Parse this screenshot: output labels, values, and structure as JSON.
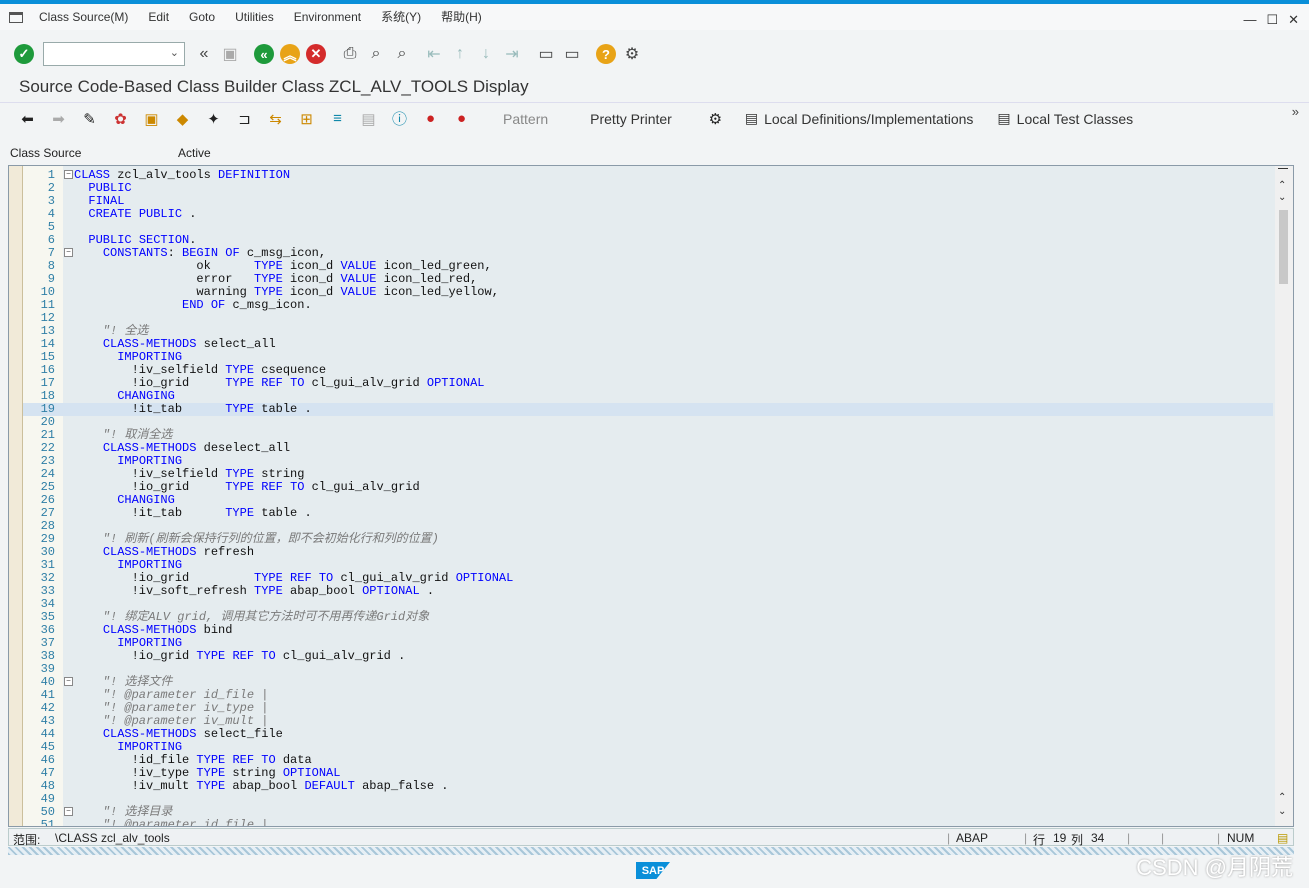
{
  "menubar": {
    "items": [
      "Class Source(M)",
      "Edit",
      "Goto",
      "Utilities",
      "Environment",
      "系统(Y)",
      "帮助(H)"
    ],
    "window_controls": [
      "—",
      "☐",
      "✕"
    ]
  },
  "toolbar": {
    "command_field_value": "",
    "icons": [
      "enter-icon",
      "back-double-icon",
      "save-icon",
      "back-icon",
      "exit-icon",
      "cancel-icon",
      "print-icon",
      "find-icon",
      "find-next-icon",
      "first-page-icon",
      "prev-page-icon",
      "next-page-icon",
      "last-page-icon",
      "new-session-icon",
      "shortcut-icon",
      "help-icon",
      "settings-icon"
    ]
  },
  "title": "Source Code-Based Class Builder Class ZCL_ALV_TOOLS Display",
  "app_toolbar": {
    "pattern_label": "Pattern",
    "pretty_printer_label": "Pretty Printer",
    "local_defs_label": "Local Definitions/Implementations",
    "local_tests_label": "Local Test Classes"
  },
  "editor": {
    "source_label": "Class Source",
    "status_label": "Active",
    "highlight_line": 19,
    "lines": [
      {
        "no": "1",
        "fold": "⊟",
        "t": "CLASS zcl_alv_tools DEFINITION"
      },
      {
        "no": "2",
        "t": "  PUBLIC"
      },
      {
        "no": "3",
        "t": "  FINAL"
      },
      {
        "no": "4",
        "t": "  CREATE PUBLIC ."
      },
      {
        "no": "5",
        "t": ""
      },
      {
        "no": "6",
        "t": "  PUBLIC SECTION."
      },
      {
        "no": "7",
        "fold": "⊟",
        "t": "    CONSTANTS: BEGIN OF c_msg_icon,"
      },
      {
        "no": "8",
        "t": "                 ok      TYPE icon_d VALUE icon_led_green,"
      },
      {
        "no": "9",
        "t": "                 error   TYPE icon_d VALUE icon_led_red,"
      },
      {
        "no": "10",
        "t": "                 warning TYPE icon_d VALUE icon_led_yellow,"
      },
      {
        "no": "11",
        "t": "               END OF c_msg_icon."
      },
      {
        "no": "12",
        "t": ""
      },
      {
        "no": "13",
        "t": "    \"! 全选"
      },
      {
        "no": "14",
        "t": "    CLASS-METHODS select_all"
      },
      {
        "no": "15",
        "t": "      IMPORTING"
      },
      {
        "no": "16",
        "t": "        !iv_selfield TYPE csequence"
      },
      {
        "no": "17",
        "t": "        !io_grid     TYPE REF TO cl_gui_alv_grid OPTIONAL"
      },
      {
        "no": "18",
        "t": "      CHANGING"
      },
      {
        "no": "19",
        "t": "        !it_tab      TYPE table ."
      },
      {
        "no": "20",
        "t": ""
      },
      {
        "no": "21",
        "t": "    \"! 取消全选"
      },
      {
        "no": "22",
        "t": "    CLASS-METHODS deselect_all"
      },
      {
        "no": "23",
        "t": "      IMPORTING"
      },
      {
        "no": "24",
        "t": "        !iv_selfield TYPE string"
      },
      {
        "no": "25",
        "t": "        !io_grid     TYPE REF TO cl_gui_alv_grid"
      },
      {
        "no": "26",
        "t": "      CHANGING"
      },
      {
        "no": "27",
        "t": "        !it_tab      TYPE table ."
      },
      {
        "no": "28",
        "t": ""
      },
      {
        "no": "29",
        "t": "    \"! 刷新(刷新会保持行列的位置，即不会初始化行和列的位置)"
      },
      {
        "no": "30",
        "t": "    CLASS-METHODS refresh"
      },
      {
        "no": "31",
        "t": "      IMPORTING"
      },
      {
        "no": "32",
        "t": "        !io_grid         TYPE REF TO cl_gui_alv_grid OPTIONAL"
      },
      {
        "no": "33",
        "t": "        !iv_soft_refresh TYPE abap_bool OPTIONAL ."
      },
      {
        "no": "34",
        "t": ""
      },
      {
        "no": "35",
        "t": "    \"! 绑定ALV grid, 调用其它方法时可不用再传递Grid对象"
      },
      {
        "no": "36",
        "t": "    CLASS-METHODS bind"
      },
      {
        "no": "37",
        "t": "      IMPORTING"
      },
      {
        "no": "38",
        "t": "        !io_grid TYPE REF TO cl_gui_alv_grid ."
      },
      {
        "no": "39",
        "t": ""
      },
      {
        "no": "40",
        "fold": "⊟",
        "t": "    \"! 选择文件"
      },
      {
        "no": "41",
        "t": "    \"! @parameter id_file |"
      },
      {
        "no": "42",
        "t": "    \"! @parameter iv_type |"
      },
      {
        "no": "43",
        "t": "    \"! @parameter iv_mult |"
      },
      {
        "no": "44",
        "t": "    CLASS-METHODS select_file"
      },
      {
        "no": "45",
        "t": "      IMPORTING"
      },
      {
        "no": "46",
        "t": "        !id_file TYPE REF TO data"
      },
      {
        "no": "47",
        "t": "        !iv_type TYPE string OPTIONAL"
      },
      {
        "no": "48",
        "t": "        !iv_mult TYPE abap_bool DEFAULT abap_false ."
      },
      {
        "no": "49",
        "t": ""
      },
      {
        "no": "50",
        "fold": "⊟",
        "t": "    \"! 选择目录"
      },
      {
        "no": "51",
        "t": "    \"! @parameter id_file |"
      }
    ]
  },
  "statusbar": {
    "scope_label": "范围:",
    "scope_value": "\\CLASS zcl_alv_tools",
    "mode": "ABAP",
    "row_label": "行",
    "row": "19",
    "col_label": "列",
    "col": "34",
    "num": "NUM"
  },
  "footer": {
    "logo": "SAP",
    "watermark": "CSDN @月阴荒"
  }
}
